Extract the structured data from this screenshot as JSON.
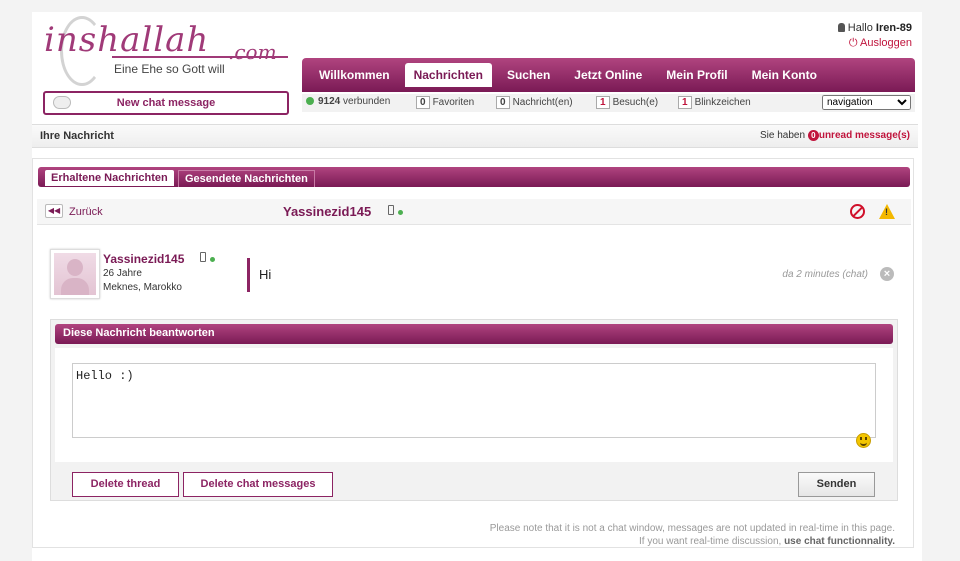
{
  "brand": {
    "name": "inshallah",
    "dotcom": ".com",
    "tagline": "Eine Ehe so Gott will"
  },
  "new_chat_label": "New chat message",
  "user": {
    "greeting": "Hallo",
    "username": "Iren-89",
    "logout": "Ausloggen"
  },
  "nav": {
    "items": [
      "Willkommen",
      "Nachrichten",
      "Suchen",
      "Jetzt Online",
      "Mein Profil",
      "Mein Konto"
    ],
    "active": "Nachrichten"
  },
  "stats": {
    "connected_count": "9124",
    "connected_label": "verbunden",
    "favorites_count": "0",
    "favorites_label": "Favoriten",
    "messages_count": "0",
    "messages_label": "Nachricht(en)",
    "visits_count": "1",
    "visits_label": "Besuch(e)",
    "blinks_count": "1",
    "blinks_label": "Blinkzeichen",
    "navigation_selected": "navigation"
  },
  "page_title": "Ihre Nachricht",
  "unread": {
    "prefix": "Sie haben",
    "count": "0",
    "label": "unread message(s)"
  },
  "tabs": {
    "received": "Erhaltene Nachrichten",
    "sent": "Gesendete Nachrichten"
  },
  "conversation": {
    "back_label": "Zurück",
    "partner": "Yassinezid145"
  },
  "message": {
    "sender": "Yassinezid145",
    "age": "26 Jahre",
    "location": "Meknes, Marokko",
    "text": "Hi",
    "time": "da 2 minutes (chat)"
  },
  "reply": {
    "heading": "Diese Nachricht beantworten",
    "text": "Hello :)",
    "delete_thread": "Delete thread",
    "delete_chat": "Delete chat messages",
    "send": "Senden"
  },
  "note": {
    "line1": "Please note that it is not a chat window, messages are not updated in real-time in this page.",
    "line2_prefix": "If you want real-time discussion,",
    "line2_link": "use chat functionnality."
  },
  "colors": {
    "brand": "#7a1a55",
    "accent_red": "#c0143c",
    "online_green": "#4caf50"
  }
}
